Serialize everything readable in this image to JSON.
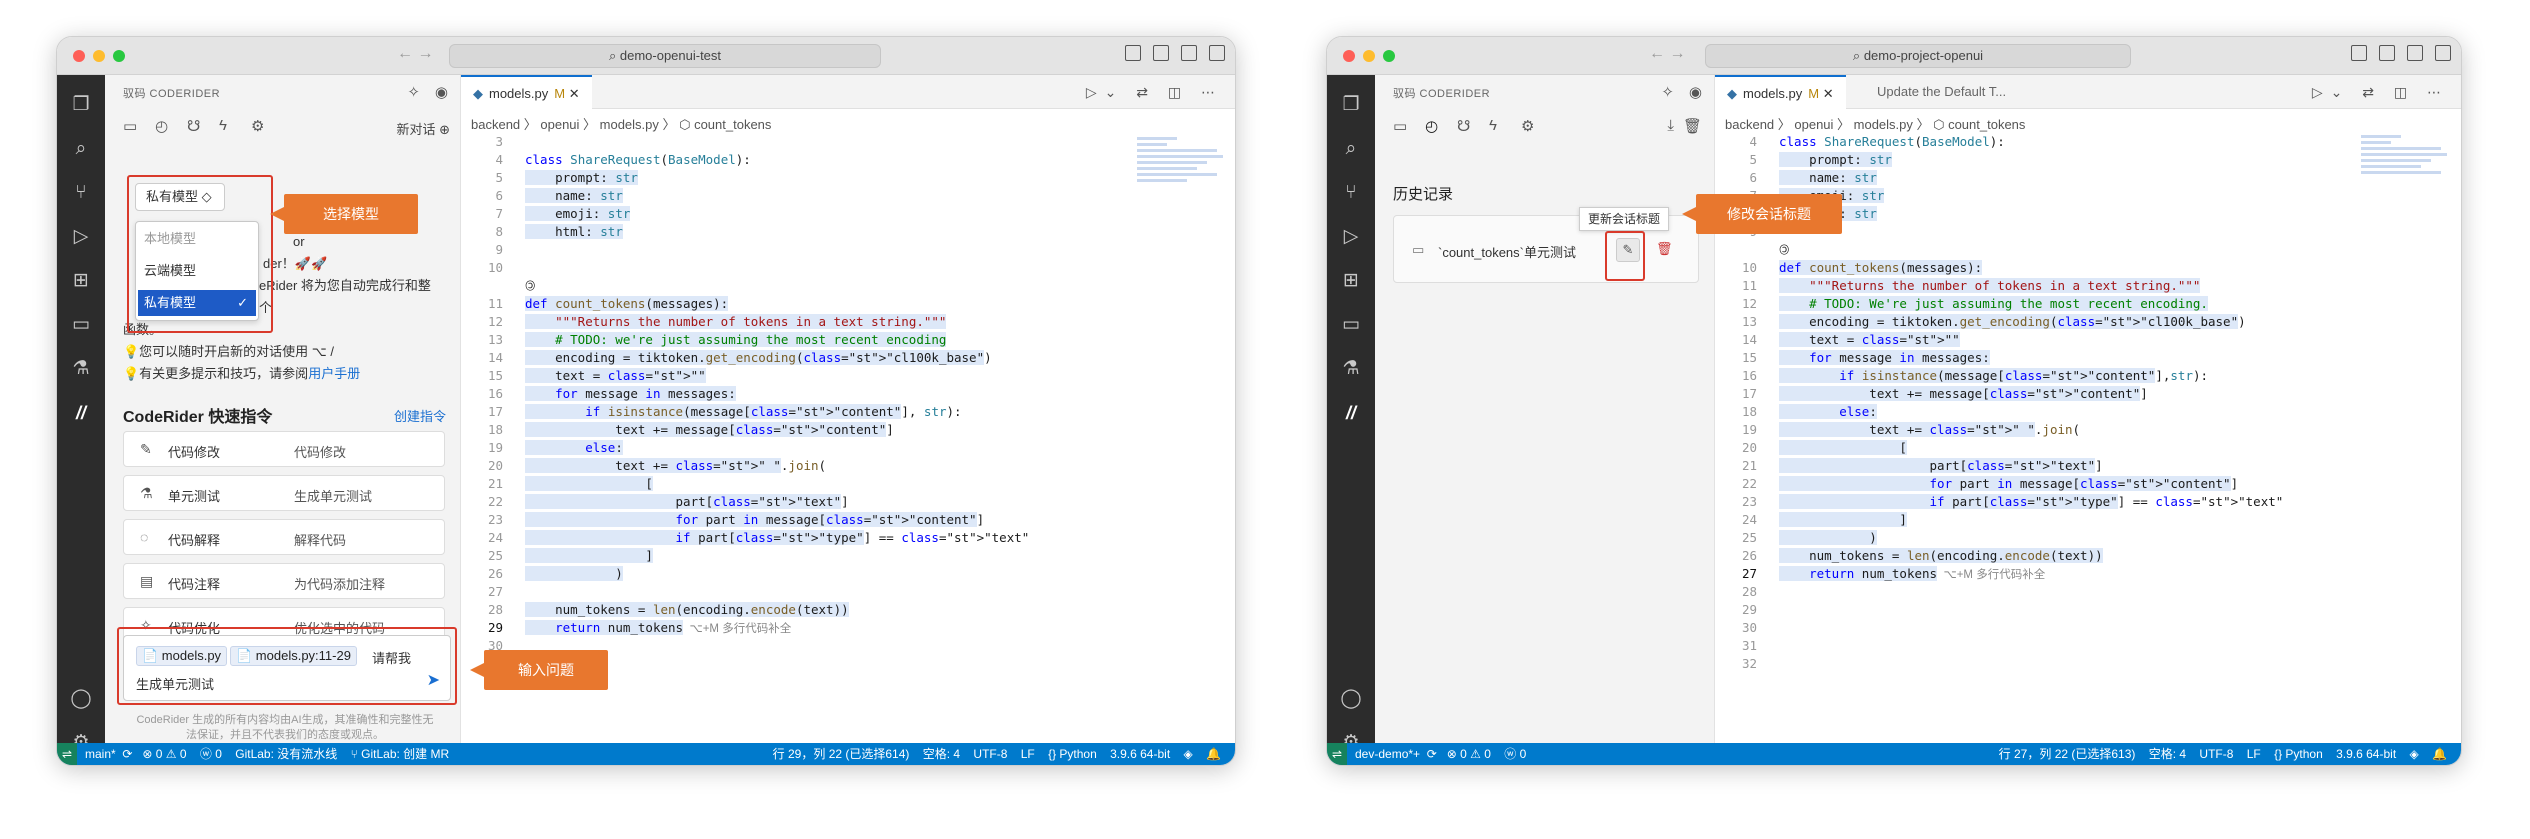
{
  "window1": {
    "title": "demo-openui-test",
    "sidebar": {
      "header": "驭码 CODERIDER",
      "new_chat": "新对话",
      "model_select": "私有模型 ◇",
      "dropdown": [
        "本地模型",
        "云端模型",
        "私有模型"
      ],
      "check": "✓",
      "welcome_line1": "or",
      "welcome_line2": "der！🚀🚀",
      "welcome_line3": "eRider 将为您自动完成行和整个",
      "welcome_line4": "函数。",
      "welcome_line5": "💡您可以随时开启新的对话使用 ⌥ /",
      "welcome_line6_prefix": "💡有关更多提示和技巧，请参阅",
      "welcome_line6_link": "用户手册",
      "quick_title": "CodeRider 快速指令",
      "quick_link": "创建指令",
      "quick": [
        {
          "icon": "✎",
          "name": "代码修改",
          "desc": "代码修改"
        },
        {
          "icon": "⚗",
          "name": "单元测试",
          "desc": "生成单元测试"
        },
        {
          "icon": "◌",
          "name": "代码解释",
          "desc": "解释代码"
        },
        {
          "icon": "▤",
          "name": "代码注释",
          "desc": "为代码添加注释"
        },
        {
          "icon": "✧",
          "name": "代码优化",
          "desc": "优化选中的代码"
        }
      ],
      "chip1": "📄 models.py",
      "chip2": "📄 models.py:11-29",
      "input_line1": "请帮我",
      "input_line2": "生成单元测试",
      "disclaimer": "CodeRider 生成的所有内容均由AI生成，其准确性和完整性无法保证，并且不代表我们的态度或观点。"
    },
    "tab": {
      "label": "models.py",
      "mod": "M",
      "close": "✕"
    },
    "breadcrumb": "backend 〉 openui 〉 models.py 〉 ⬡ count_tokens",
    "lines": [
      {
        "n": "3",
        "t": ""
      },
      {
        "n": "4",
        "t": "class ShareRequest(BaseModel):"
      },
      {
        "n": "5",
        "t": "    prompt: str"
      },
      {
        "n": "6",
        "t": "    name: str"
      },
      {
        "n": "7",
        "t": "    emoji: str"
      },
      {
        "n": "8",
        "t": "    html: str"
      },
      {
        "n": "9",
        "t": ""
      },
      {
        "n": "10",
        "t": ""
      },
      {
        "n": "",
        "t": "🄯"
      },
      {
        "n": "11",
        "t": "def count_tokens(messages):"
      },
      {
        "n": "12",
        "t": "    \"\"\"Returns the number of tokens in a text string.\"\"\""
      },
      {
        "n": "13",
        "t": "    # TODO: we're just assuming the most recent encoding"
      },
      {
        "n": "14",
        "t": "    encoding = tiktoken.get_encoding(\"cl100k_base\")"
      },
      {
        "n": "15",
        "t": "    text = \"\""
      },
      {
        "n": "16",
        "t": "    for message in messages:"
      },
      {
        "n": "17",
        "t": "        if isinstance(message[\"content\"], str):"
      },
      {
        "n": "18",
        "t": "            text += message[\"content\"]"
      },
      {
        "n": "19",
        "t": "        else:"
      },
      {
        "n": "20",
        "t": "            text += \" \".join("
      },
      {
        "n": "21",
        "t": "                ["
      },
      {
        "n": "22",
        "t": "                    part[\"text\"]"
      },
      {
        "n": "23",
        "t": "                    for part in message[\"content\"]"
      },
      {
        "n": "24",
        "t": "                    if part[\"type\"] == \"text\""
      },
      {
        "n": "25",
        "t": "                ]"
      },
      {
        "n": "26",
        "t": "            )"
      },
      {
        "n": "27",
        "t": ""
      },
      {
        "n": "28",
        "t": "    num_tokens = len(encoding.encode(text))"
      },
      {
        "n": "29",
        "t": "    return num_tokens"
      },
      {
        "n": "30",
        "t": ""
      }
    ],
    "ghost": "⌥+M 多行代码补全",
    "status_left": "main*  ⟳   ⊗ 0 ⚠ 0    ⓦ 0    GitLab: 没有流水线    ⑂ GitLab: 创建 MR",
    "status_right": "行 29，列 22 (已选择614)    空格: 4    UTF-8    LF    {} Python    3.9.6 64-bit    ◈    🔔",
    "callout_model": "选择模型",
    "callout_input": "输入问题"
  },
  "window2": {
    "title": "demo-project-openui",
    "sidebar": {
      "header": "驭码 CODERIDER",
      "history_title": "历史记录",
      "history_item": "`count_tokens`单元测试",
      "tooltip": "更新会话标题",
      "edit_icon": "✎",
      "delete_icon": "🗑"
    },
    "tab1": {
      "label": "models.py",
      "mod": "M",
      "close": "✕"
    },
    "tab2": {
      "label": "Update the Default T..."
    },
    "breadcrumb": "backend 〉 openui 〉 models.py 〉 ⬡ count_tokens",
    "lines": [
      {
        "n": "4",
        "t": "class ShareRequest(BaseModel):"
      },
      {
        "n": "5",
        "t": "    prompt: str"
      },
      {
        "n": "6",
        "t": "    name: str"
      },
      {
        "n": "7",
        "t": "    emoji: str"
      },
      {
        "n": "8",
        "t": "    html: str"
      },
      {
        "n": "9",
        "t": ""
      },
      {
        "n": "",
        "t": "🄯"
      },
      {
        "n": "10",
        "t": "def count_tokens(messages):"
      },
      {
        "n": "11",
        "t": "    \"\"\"Returns the number of tokens in a text string.\"\"\""
      },
      {
        "n": "12",
        "t": "    # TODO: We're just assuming the most recent encoding."
      },
      {
        "n": "13",
        "t": "    encoding = tiktoken.get_encoding(\"cl100k_base\")"
      },
      {
        "n": "14",
        "t": "    text = \"\""
      },
      {
        "n": "15",
        "t": "    for message in messages:"
      },
      {
        "n": "16",
        "t": "        if isinstance(message[\"content\"],str):"
      },
      {
        "n": "17",
        "t": "            text += message[\"content\"]"
      },
      {
        "n": "18",
        "t": "        else:"
      },
      {
        "n": "19",
        "t": "            text += \" \".join("
      },
      {
        "n": "20",
        "t": "                ["
      },
      {
        "n": "21",
        "t": "                    part[\"text\"]"
      },
      {
        "n": "22",
        "t": "                    for part in message[\"content\"]"
      },
      {
        "n": "23",
        "t": "                    if part[\"type\"] == \"text\""
      },
      {
        "n": "24",
        "t": "                ]"
      },
      {
        "n": "25",
        "t": "            )"
      },
      {
        "n": "26",
        "t": "    num_tokens = len(encoding.encode(text))"
      },
      {
        "n": "27",
        "t": "    return num_tokens"
      },
      {
        "n": "28",
        "t": ""
      },
      {
        "n": "29",
        "t": ""
      },
      {
        "n": "30",
        "t": ""
      },
      {
        "n": "31",
        "t": ""
      },
      {
        "n": "32",
        "t": ""
      }
    ],
    "ghost": "⌥+M 多行代码补全",
    "status_left": "dev-demo*+  ⟳   ⊗ 0 ⚠ 0    ⓦ 0",
    "status_right": "行 27，列 22 (已选择613)    空格: 4    UTF-8    LF    {} Python    3.9.6 64-bit    ◈    🔔",
    "callout_edit": "修改会话标题"
  },
  "colors": {
    "accent": "#007acc",
    "callout": "#e8772e",
    "redbox": "#d93a2b",
    "activity": "#2c2c2c"
  }
}
